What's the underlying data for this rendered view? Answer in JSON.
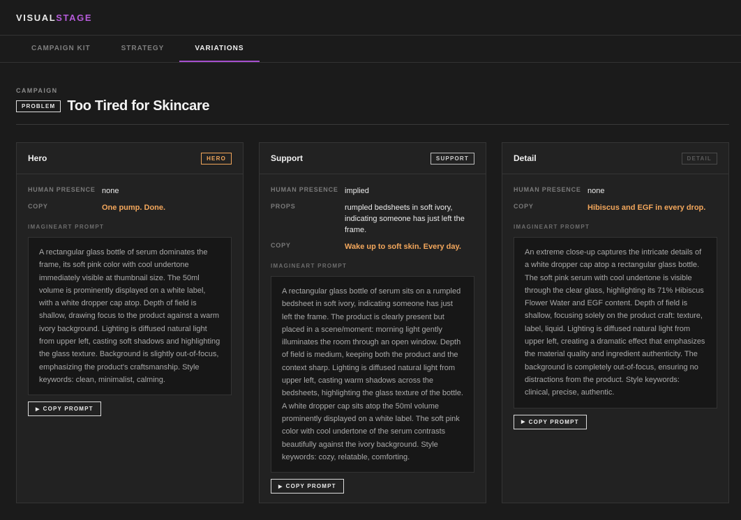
{
  "app": {
    "logo_part1": "VISUAL",
    "logo_part2": "STAGE",
    "accent_color": "#b55bd9"
  },
  "tabs": [
    {
      "label": "CAMPAIGN KIT",
      "active": false
    },
    {
      "label": "STRATEGY",
      "active": false
    },
    {
      "label": "VARIATIONS",
      "active": true
    }
  ],
  "campaign": {
    "section_label": "CAMPAIGN",
    "badge": "PROBLEM",
    "title": "Too Tired for Skincare"
  },
  "labels": {
    "human_presence": "HUMAN PRESENCE",
    "props": "PROPS",
    "copy": "COPY",
    "prompt": "IMAGINEART PROMPT",
    "copy_prompt_button": "COPY PROMPT",
    "copy_prompt_icon": "play-icon"
  },
  "cards": [
    {
      "title": "Hero",
      "tag": "HERO",
      "human_presence": "none",
      "copy": "One pump. Done.",
      "prompt": "A rectangular glass bottle of serum dominates the frame, its soft pink color with cool undertone immediately visible at thumbnail size. The 50ml volume is prominently displayed on a white label, with a white dropper cap atop. Depth of field is shallow, drawing focus to the product against a warm ivory background. Lighting is diffused natural light from upper left, casting soft shadows and highlighting the glass texture. Background is slightly out-of-focus, emphasizing the product's craftsmanship. Style keywords: clean, minimalist, calming."
    },
    {
      "title": "Support",
      "tag": "SUPPORT",
      "human_presence": "implied",
      "props": "rumpled bedsheets in soft ivory, indicating someone has just left the frame.",
      "copy": "Wake up to soft skin. Every day.",
      "prompt": "A rectangular glass bottle of serum sits on a rumpled bedsheet in soft ivory, indicating someone has just left the frame. The product is clearly present but placed in a scene/moment: morning light gently illuminates the room through an open window. Depth of field is medium, keeping both the product and the context sharp. Lighting is diffused natural light from upper left, casting warm shadows across the bedsheets, highlighting the glass texture of the bottle. A white dropper cap sits atop the 50ml volume prominently displayed on a white label. The soft pink color with cool undertone of the serum contrasts beautifully against the ivory background. Style keywords: cozy, relatable, comforting."
    },
    {
      "title": "Detail",
      "tag": "DETAIL",
      "human_presence": "none",
      "copy": "Hibiscus and EGF in every drop.",
      "prompt": "An extreme close-up captures the intricate details of a white dropper cap atop a rectangular glass bottle. The soft pink serum with cool undertone is visible through the clear glass, highlighting its 71% Hibiscus Flower Water and EGF content. Depth of field is shallow, focusing solely on the product craft: texture, label, liquid. Lighting is diffused natural light from upper left, creating a dramatic effect that emphasizes the material quality and ingredient authenticity. The background is completely out-of-focus, ensuring no distractions from the product. Style keywords: clinical, precise, authentic."
    }
  ]
}
